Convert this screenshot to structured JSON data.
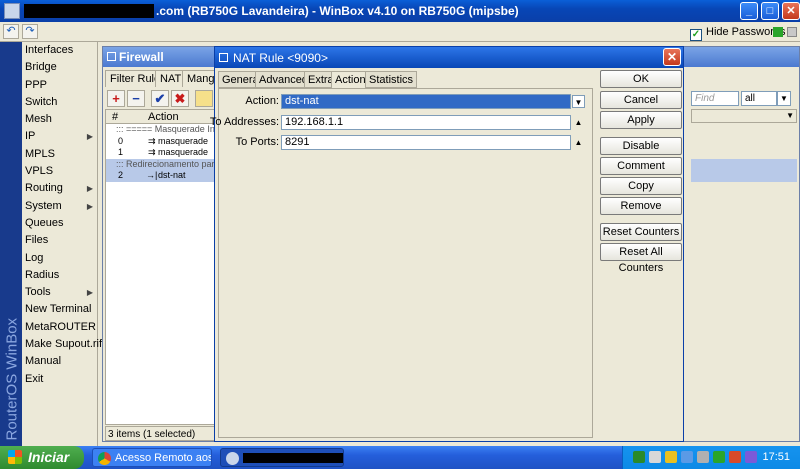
{
  "window": {
    "title": ".com (RB750G Lavandeira) - WinBox v4.10 on RB750G (mipsbe)"
  },
  "toolbar": {
    "undo_icon": "undo-icon",
    "redo_icon": "redo-icon",
    "hide_passwords_label": "Hide Passwords",
    "hide_passwords_checked": true
  },
  "banner": "RouterOS WinBox",
  "sidebar": {
    "items": [
      {
        "label": "Interfaces",
        "submenu": false
      },
      {
        "label": "Bridge",
        "submenu": false
      },
      {
        "label": "PPP",
        "submenu": false
      },
      {
        "label": "Switch",
        "submenu": false
      },
      {
        "label": "Mesh",
        "submenu": false
      },
      {
        "label": "IP",
        "submenu": true
      },
      {
        "label": "MPLS",
        "submenu": false
      },
      {
        "label": "VPLS",
        "submenu": false
      },
      {
        "label": "Routing",
        "submenu": true
      },
      {
        "label": "System",
        "submenu": true
      },
      {
        "label": "Queues",
        "submenu": false
      },
      {
        "label": "Files",
        "submenu": false
      },
      {
        "label": "Log",
        "submenu": false
      },
      {
        "label": "Radius",
        "submenu": false
      },
      {
        "label": "Tools",
        "submenu": true
      },
      {
        "label": "New Terminal",
        "submenu": false
      },
      {
        "label": "MetaROUTER",
        "submenu": false
      },
      {
        "label": "Make Supout.rif",
        "submenu": false
      },
      {
        "label": "Manual",
        "submenu": false
      },
      {
        "label": "Exit",
        "submenu": false
      }
    ]
  },
  "firewall": {
    "title": "Firewall",
    "tabs": [
      "Filter Rules",
      "NAT",
      "Mangle"
    ],
    "columns": [
      "#",
      "Action"
    ],
    "rows": [
      {
        "num": "",
        "action": "::: ===== Masquerade Int",
        "type": "comment"
      },
      {
        "num": "0",
        "action": "masquerade",
        "type": "rule"
      },
      {
        "num": "1",
        "action": "masquerade",
        "type": "rule"
      },
      {
        "num": "",
        "action": "::: Redirecionamento para",
        "type": "comment"
      },
      {
        "num": "2",
        "action": "dst-nat",
        "type": "selected"
      }
    ],
    "find_placeholder": "Find",
    "filter_value": "all",
    "status": "3 items (1 selected)"
  },
  "nat_dialog": {
    "title": "NAT Rule <9090>",
    "tabs": [
      "General",
      "Advanced",
      "Extra",
      "Action",
      "Statistics"
    ],
    "active_tab": "Action",
    "fields": {
      "action_label": "Action:",
      "action_value": "dst-nat",
      "to_addresses_label": "To Addresses:",
      "to_addresses_value": "192.168.1.1",
      "to_ports_label": "To Ports:",
      "to_ports_value": "8291"
    },
    "buttons": [
      "OK",
      "Cancel",
      "Apply",
      "Disable",
      "Comment",
      "Copy",
      "Remove",
      "Reset Counters",
      "Reset All Counters"
    ]
  },
  "taskbar": {
    "start_label": "Iniciar",
    "tasks": [
      {
        "label": "Acesso Remoto aos ..."
      },
      {
        "label": ""
      }
    ],
    "clock": "17:51"
  }
}
